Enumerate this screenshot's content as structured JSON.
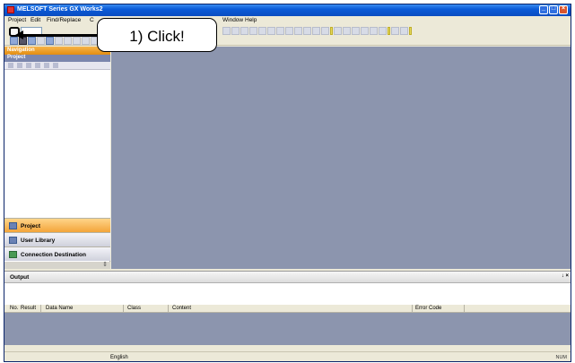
{
  "window": {
    "title": "MELSOFT Series GX Works2"
  },
  "menu": {
    "items": [
      {
        "label": "Project"
      },
      {
        "label": "Edit"
      },
      {
        "label": "Find/Replace"
      },
      {
        "label": "C"
      },
      {
        "label": "Window"
      },
      {
        "label": "Help"
      }
    ]
  },
  "navigation": {
    "header": "Navigation",
    "header_controls": "↓ ×",
    "project_label": "Project",
    "sections": [
      {
        "label": "Project",
        "active": true,
        "icon": "project-icon"
      },
      {
        "label": "User Library",
        "active": false,
        "icon": "user-library-icon"
      },
      {
        "label": "Connection Destination",
        "active": false,
        "icon": "connection-destination-icon"
      }
    ]
  },
  "output": {
    "title": "Output",
    "pin": "↓ ×",
    "columns": [
      {
        "label": "No."
      },
      {
        "label": "Result"
      },
      {
        "label": "Data Name"
      },
      {
        "label": "Class"
      },
      {
        "label": "Content"
      },
      {
        "label": "Error Code"
      }
    ]
  },
  "statusbar": {
    "language": "English",
    "num": "NUM"
  },
  "annotation": {
    "text": "1) Click!"
  },
  "colors": {
    "titlebar": "#0b5bd8",
    "workspace": "#8c95ae",
    "nav_header": "#e38d12",
    "active_section": "#f3a43a"
  }
}
